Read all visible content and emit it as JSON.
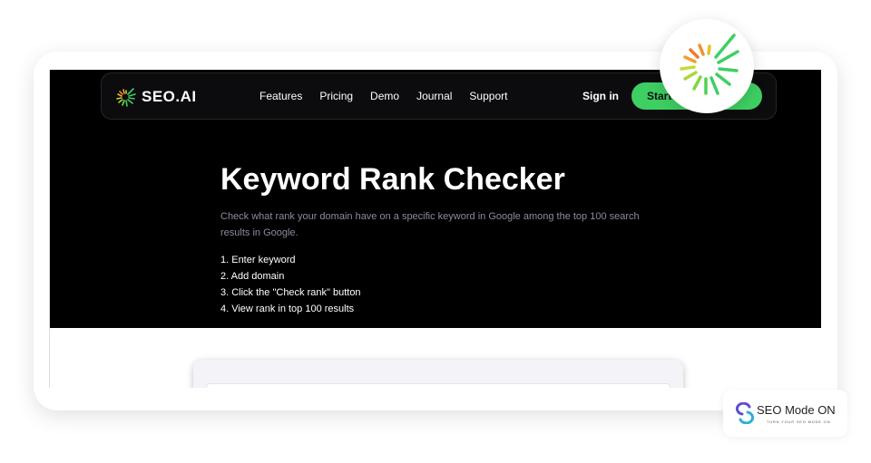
{
  "nav": {
    "logo_text": "SEO.AI",
    "links": [
      "Features",
      "Pricing",
      "Demo",
      "Journal",
      "Support"
    ],
    "sign_in": "Sign in",
    "start_label": "Start"
  },
  "hero": {
    "title": "Keyword Rank Checker",
    "description": "Check what rank your domain have on a specific keyword in Google among the top 100 search results in Google.",
    "steps": [
      "1. Enter keyword",
      "2. Add domain",
      "3. Click the \"Check rank\" button",
      "4. View rank in top 100 results"
    ]
  },
  "brand": {
    "name": "SEO Mode ON",
    "tagline": "TURN YOUR SEO MODE ON"
  },
  "colors": {
    "accent": "#3ecf63",
    "hero_bg": "#000000"
  }
}
